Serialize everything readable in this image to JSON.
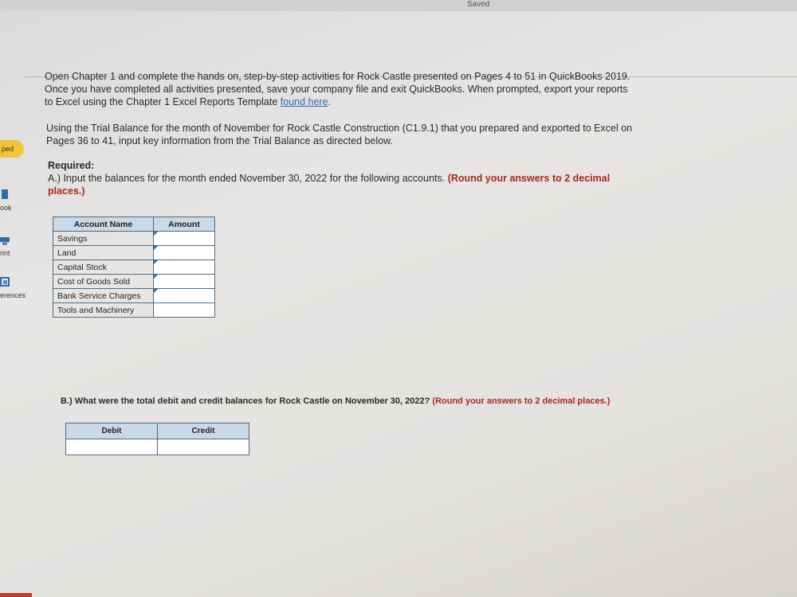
{
  "header": {
    "status": "Saved"
  },
  "sidebar": {
    "tab_label": "ped",
    "items": [
      {
        "label": "ook"
      },
      {
        "label": "rint"
      },
      {
        "label": "erences"
      }
    ]
  },
  "instructions": {
    "line1": "Open Chapter 1 and complete the hands on, step-by-step activities for Rock Castle presented on Pages 4 to 51 in QuickBooks 2019.",
    "line2": "Once you have completed all activities presented, save your company file and exit QuickBooks. When prompted, export your reports",
    "line3_prefix": "to Excel using the Chapter 1 Excel Reports Template ",
    "link_text": "found here",
    "line3_suffix": ".",
    "line4": "Using the Trial Balance for the month of November for Rock Castle Construction (C1.9.1) that you prepared and exported to Excel on",
    "line5": "Pages 36 to 41, input key information from the Trial Balance as directed below."
  },
  "required": {
    "heading": "Required:",
    "part_a_text": "A.) Input the balances for the month ended November 30, 2022 for the following accounts. ",
    "part_a_round_1": "(Round your answers to 2 decimal",
    "part_a_round_2": "places.)"
  },
  "accounts_table": {
    "headers": {
      "name": "Account Name",
      "amount": "Amount"
    },
    "rows": [
      {
        "name": "Savings",
        "amount": ""
      },
      {
        "name": "Land",
        "amount": ""
      },
      {
        "name": "Capital Stock",
        "amount": ""
      },
      {
        "name": "Cost of Goods Sold",
        "amount": ""
      },
      {
        "name": "Bank Service Charges",
        "amount": ""
      },
      {
        "name": "Tools and Machinery",
        "amount": ""
      }
    ]
  },
  "part_b": {
    "text": "B.) What were the total debit and credit balances for Rock Castle on November 30, 2022? ",
    "round": "(Round your answers to 2 decimal places.)"
  },
  "totals_table": {
    "headers": {
      "debit": "Debit",
      "credit": "Credit"
    },
    "values": {
      "debit": "",
      "credit": ""
    }
  },
  "colors": {
    "accent_blue": "#2a6fb5",
    "instruction_red": "#a8281e",
    "table_header": "#c9d9e6",
    "sidebar_tab": "#f3c437"
  }
}
